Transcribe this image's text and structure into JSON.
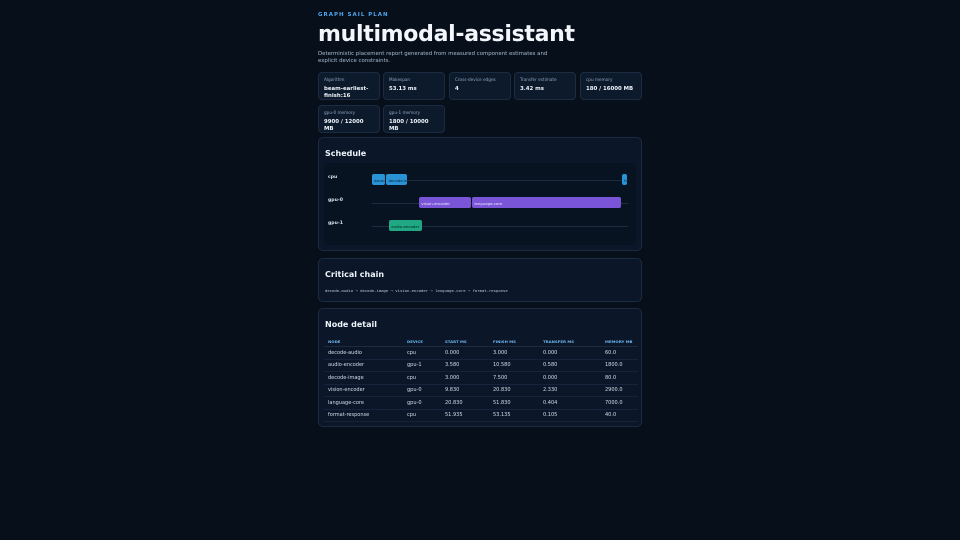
{
  "header": {
    "eyebrow": "GRAPH SAIL PLAN",
    "title": "multimodal-assistant",
    "subtitle": "Deterministic placement report generated from measured component estimates and explicit device constraints."
  },
  "stats": [
    {
      "label": "Algorithm",
      "value": "beam-earliest-finish:16"
    },
    {
      "label": "Makespan",
      "value": "53.13 ms"
    },
    {
      "label": "Cross-device edges",
      "value": "4"
    },
    {
      "label": "Transfer estimate",
      "value": "3.42 ms"
    },
    {
      "label": "cpu memory",
      "value": "180 / 16000 MB"
    },
    {
      "label": "gpu-0 memory",
      "value": "9900 / 12000 MB"
    },
    {
      "label": "gpu-1 memory",
      "value": "1800 / 10000 MB"
    }
  ],
  "schedule": {
    "title": "Schedule",
    "makespan_ms": 53.135,
    "lanes": [
      {
        "name": "cpu",
        "tasks": [
          {
            "label": "decode-audio",
            "start": 0.0,
            "finish": 3.0
          },
          {
            "label": "decode-image",
            "start": 3.0,
            "finish": 7.5
          },
          {
            "label": "format-response",
            "start": 51.935,
            "finish": 53.135
          }
        ]
      },
      {
        "name": "gpu-0",
        "tasks": [
          {
            "label": "vision-encoder",
            "start": 9.83,
            "finish": 20.83
          },
          {
            "label": "language-core",
            "start": 20.83,
            "finish": 51.83
          }
        ]
      },
      {
        "name": "gpu-1",
        "tasks": [
          {
            "label": "audio-encoder",
            "start": 3.58,
            "finish": 10.58
          }
        ]
      }
    ]
  },
  "critical": {
    "title": "Critical chain",
    "chain": "decode-audio → decode-image → vision-encoder → language-core → format-response"
  },
  "nodes": {
    "title": "Node detail",
    "columns": [
      "NODE",
      "DEVICE",
      "START MS",
      "FINISH MS",
      "TRANSFER MS",
      "MEMORY MB"
    ],
    "rows": [
      [
        "decode-audio",
        "cpu",
        "0.000",
        "3.000",
        "0.000",
        "60.0"
      ],
      [
        "audio-encoder",
        "gpu-1",
        "3.580",
        "10.580",
        "0.580",
        "1800.0"
      ],
      [
        "decode-image",
        "cpu",
        "3.000",
        "7.500",
        "0.000",
        "80.0"
      ],
      [
        "vision-encoder",
        "gpu-0",
        "9.830",
        "20.830",
        "2.330",
        "2900.0"
      ],
      [
        "language-core",
        "gpu-0",
        "20.830",
        "51.830",
        "0.404",
        "7000.0"
      ],
      [
        "format-response",
        "cpu",
        "51.935",
        "53.135",
        "0.105",
        "40.0"
      ]
    ]
  },
  "colors": {
    "cpu": "#2a93d5",
    "gpu-0": "#7b55d8",
    "gpu-1": "#1fa883",
    "accent": "#4ea8f0"
  }
}
